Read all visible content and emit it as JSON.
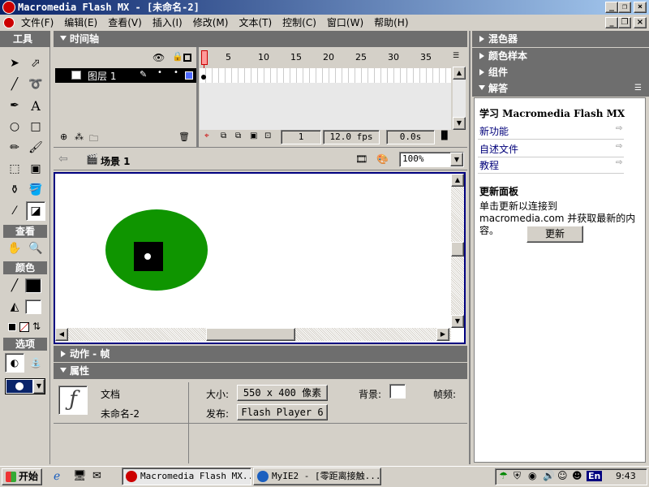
{
  "window": {
    "title": "Macromedia Flash MX - [未命名-2]",
    "min": "_",
    "restore": "❐",
    "close": "×"
  },
  "menu": [
    "文件(F)",
    "编辑(E)",
    "查看(V)",
    "插入(I)",
    "修改(M)",
    "文本(T)",
    "控制(C)",
    "窗口(W)",
    "帮助(H)"
  ],
  "tools": {
    "title": "工具",
    "view_title": "查看",
    "colors_title": "颜色",
    "options_title": "选项"
  },
  "timeline": {
    "title": "时间轴",
    "frame_numbers": [
      "1",
      "5",
      "10",
      "15",
      "20",
      "25",
      "30",
      "35"
    ],
    "layer_name": "图层 1",
    "current_frame": "1",
    "fps": "12.0 fps",
    "time": "0.0s"
  },
  "scene": {
    "name": "场景 1",
    "zoom": "100%"
  },
  "actions": {
    "title": "动作 - 帧"
  },
  "properties": {
    "title": "属性",
    "doc_label": "文档",
    "doc_name": "未命名-2",
    "size_label": "大小:",
    "size_value": "550 x 400 像素",
    "bg_label": "背景:",
    "fps_label": "帧频:",
    "publish_label": "发布:",
    "publish_value": "Flash Player 6"
  },
  "right_panels": {
    "mixer": "混色器",
    "swatches": "颜色样本",
    "components": "组件",
    "answers": "解答"
  },
  "answers": {
    "heading": "学习 Macromedia Flash MX",
    "links": [
      "新功能",
      "自述文件",
      "教程"
    ],
    "update_title": "更新面板",
    "update_text": "单击更新以连接到 macromedia.com 并获取最新的内容。",
    "update_button": "更新"
  },
  "taskbar": {
    "start": "开始",
    "items": [
      "Macromedia Flash MX...",
      "MyIE2 - [零距离接触..."
    ],
    "ime": "En",
    "clock": "9:43"
  },
  "colors": {
    "accent": "#0a246a",
    "panel": "#6e6e6e",
    "ellipse": "#0f9500",
    "stroke": "#000000",
    "fill": "#ffffff"
  }
}
